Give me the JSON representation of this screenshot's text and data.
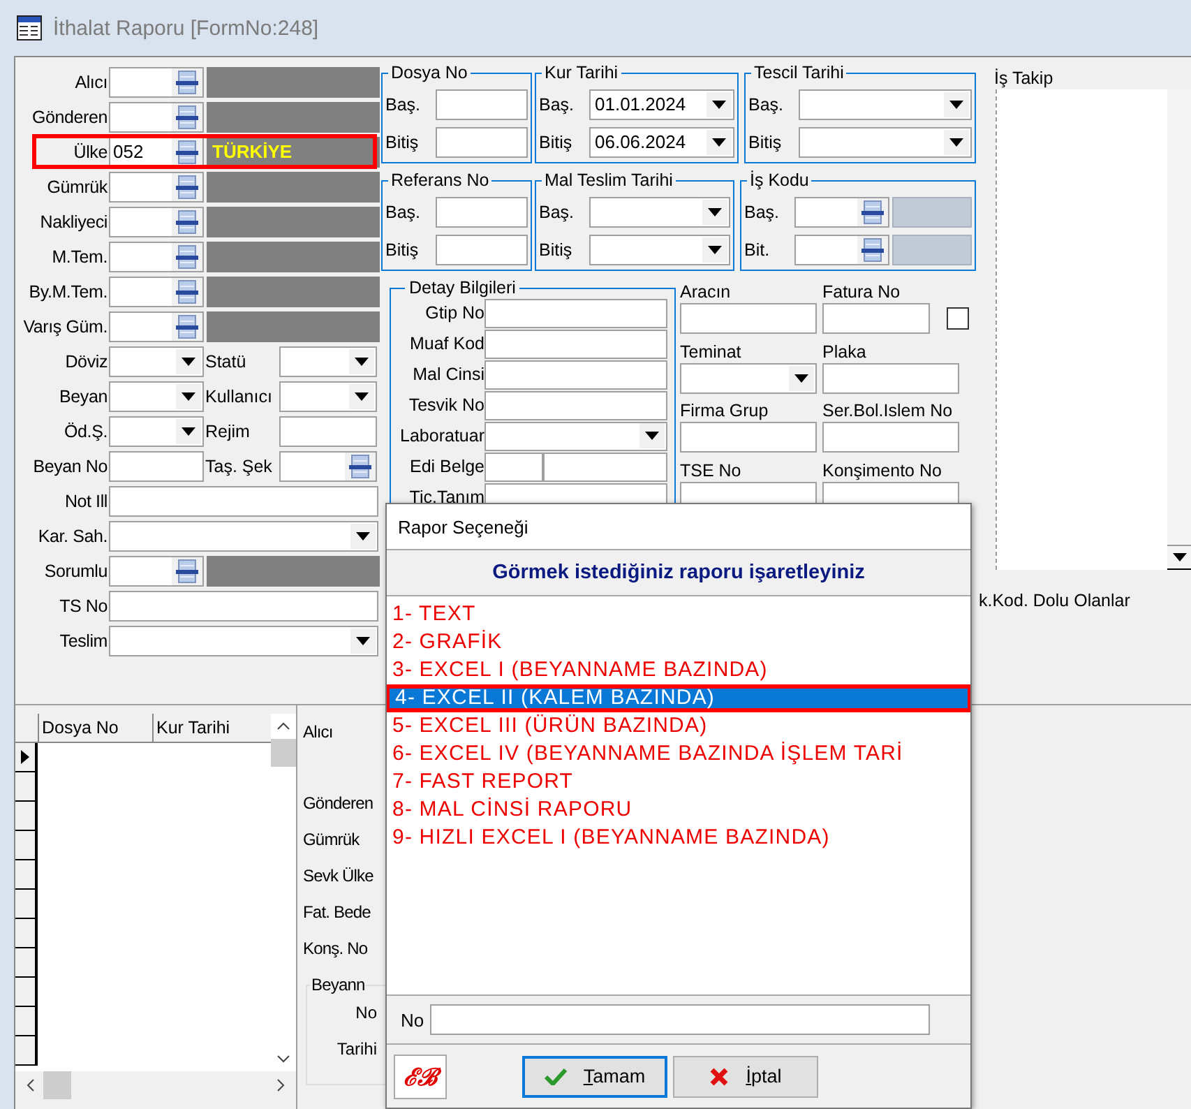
{
  "window": {
    "title": "İthalat Raporu [FormNo:248]"
  },
  "filters": [
    {
      "label": "Alıcı",
      "highlighted": false,
      "controls": [
        {
          "kind": "lookup"
        },
        {
          "kind": "name"
        }
      ]
    },
    {
      "label": "Gönderen",
      "highlighted": false,
      "controls": [
        {
          "kind": "lookup"
        },
        {
          "kind": "name"
        }
      ]
    },
    {
      "label": "Ülke",
      "highlighted": true,
      "controls": [
        {
          "kind": "lookup",
          "value": "052"
        },
        {
          "kind": "name",
          "value": "TÜRKİYE"
        }
      ]
    },
    {
      "label": "Gümrük",
      "highlighted": false,
      "controls": [
        {
          "kind": "lookup"
        },
        {
          "kind": "name"
        }
      ]
    },
    {
      "label": "Nakliyeci",
      "highlighted": false,
      "controls": [
        {
          "kind": "lookup"
        },
        {
          "kind": "name"
        }
      ]
    },
    {
      "label": "M.Tem.",
      "highlighted": false,
      "controls": [
        {
          "kind": "lookup"
        },
        {
          "kind": "name"
        }
      ]
    },
    {
      "label": "By.M.Tem.",
      "highlighted": false,
      "controls": [
        {
          "kind": "lookup"
        },
        {
          "kind": "name"
        }
      ]
    },
    {
      "label": "Varış Güm.",
      "highlighted": false,
      "controls": [
        {
          "kind": "lookup"
        },
        {
          "kind": "name"
        }
      ]
    },
    {
      "label": "Döviz",
      "highlighted": false,
      "controls": [
        {
          "kind": "combo"
        },
        {
          "kind": "label",
          "text": "Statü"
        },
        {
          "kind": "combo"
        }
      ]
    },
    {
      "label": "Beyan",
      "highlighted": false,
      "controls": [
        {
          "kind": "combo"
        },
        {
          "kind": "label",
          "text": "Kullanıcı"
        },
        {
          "kind": "combo"
        }
      ]
    },
    {
      "label": "Öd.Ş.",
      "highlighted": false,
      "controls": [
        {
          "kind": "combo"
        },
        {
          "kind": "label",
          "text": "Rejim"
        },
        {
          "kind": "text"
        }
      ]
    },
    {
      "label": "Beyan No",
      "highlighted": false,
      "controls": [
        {
          "kind": "text"
        },
        {
          "kind": "label",
          "text": "Taş. Şek"
        },
        {
          "kind": "lookup"
        }
      ]
    },
    {
      "label": "Not Ill",
      "highlighted": false,
      "controls": [
        {
          "kind": "text"
        }
      ]
    },
    {
      "label": "Kar. Sah.",
      "highlighted": false,
      "controls": [
        {
          "kind": "combo"
        }
      ]
    },
    {
      "label": "Sorumlu",
      "highlighted": false,
      "controls": [
        {
          "kind": "lookup"
        },
        {
          "kind": "name"
        }
      ]
    },
    {
      "label": "TS No",
      "highlighted": false,
      "controls": [
        {
          "kind": "text"
        }
      ]
    },
    {
      "label": "Teslim",
      "highlighted": false,
      "controls": [
        {
          "kind": "combo"
        }
      ]
    }
  ],
  "groups": [
    {
      "title": "Dosya No",
      "rows": [
        {
          "label": "Baş.",
          "kind": "text"
        },
        {
          "label": "Bitiş",
          "kind": "text"
        }
      ]
    },
    {
      "title": "Kur Tarihi",
      "rows": [
        {
          "label": "Baş.",
          "kind": "combo",
          "value": "01.01.2024"
        },
        {
          "label": "Bitiş",
          "kind": "combo",
          "value": "06.06.2024"
        }
      ]
    },
    {
      "title": "Tescil Tarihi",
      "rows": [
        {
          "label": "Baş.",
          "kind": "combo"
        },
        {
          "label": "Bitiş",
          "kind": "combo"
        }
      ]
    },
    {
      "title": "Referans No",
      "rows": [
        {
          "label": "Baş.",
          "kind": "text"
        },
        {
          "label": "Bitiş",
          "kind": "text"
        }
      ]
    },
    {
      "title": "Mal Teslim Tarihi",
      "rows": [
        {
          "label": "Baş.",
          "kind": "combo"
        },
        {
          "label": "Bitiş",
          "kind": "combo"
        }
      ]
    },
    {
      "title": "İş Kodu",
      "rows": [
        {
          "label": "Baş.",
          "kind": "lookup"
        },
        {
          "label": "Bit.",
          "kind": "lookup"
        }
      ]
    }
  ],
  "detail": {
    "title": "Detay Bilgileri",
    "rows": [
      {
        "label": "Gtip No",
        "kind": "text"
      },
      {
        "label": "Muaf Kod",
        "kind": "text"
      },
      {
        "label": "Mal Cinsi",
        "kind": "text"
      },
      {
        "label": "Tesvik No",
        "kind": "text"
      },
      {
        "label": "Laboratuar",
        "kind": "combo"
      },
      {
        "label": "Edi Belge",
        "kind": "split"
      },
      {
        "label": "Tic.Tanım",
        "kind": "text"
      }
    ]
  },
  "extra_fields": [
    {
      "label": "Aracın",
      "kind": "text"
    },
    {
      "label": "Fatura No",
      "kind": "text_check",
      "checked": false
    },
    {
      "label": "Teminat",
      "kind": "combo"
    },
    {
      "label": "Plaka",
      "kind": "text"
    },
    {
      "label": "Firma Grup",
      "kind": "text"
    },
    {
      "label": "Ser.Bol.Islem No",
      "kind": "text"
    },
    {
      "label": "TSE No",
      "kind": "text"
    },
    {
      "label": "Konşimento No",
      "kind": "text"
    }
  ],
  "is_takip": {
    "label": "İş Takip"
  },
  "side_note": "k.Kod. Dolu Olanlar",
  "grid": {
    "columns": [
      "Dosya No",
      "Kur Tarihi"
    ],
    "rows": [
      {
        "current": true
      },
      {
        "current": false
      },
      {
        "current": false
      },
      {
        "current": false
      },
      {
        "current": false
      },
      {
        "current": false
      },
      {
        "current": false
      },
      {
        "current": false
      },
      {
        "current": false
      },
      {
        "current": false
      },
      {
        "current": false
      }
    ]
  },
  "detail_panel": {
    "labels": [
      "Alıcı",
      "Gönderen",
      "Gümrük",
      "Sevk Ülke",
      "Fat. Bede",
      "Konş. No"
    ],
    "group": {
      "title": "Beyann",
      "labels": [
        "No",
        "Tarihi"
      ]
    }
  },
  "dialog": {
    "title": "Rapor Seçeneği",
    "heading": "Görmek istediğiniz raporu işaretleyiniz",
    "options": [
      {
        "label": "1- TEXT",
        "selected": false,
        "highlighted": false
      },
      {
        "label": "2- GRAFİK",
        "selected": false,
        "highlighted": false
      },
      {
        "label": "3- EXCEL I (BEYANNAME BAZINDA)",
        "selected": false,
        "highlighted": false
      },
      {
        "label": "4- EXCEL II (KALEM BAZINDA)",
        "selected": true,
        "highlighted": true
      },
      {
        "label": "5- EXCEL III (ÜRÜN BAZINDA)",
        "selected": false,
        "highlighted": false
      },
      {
        "label": "6- EXCEL IV (BEYANNAME BAZINDA İŞLEM TARİ",
        "selected": false,
        "highlighted": false
      },
      {
        "label": "7- FAST REPORT",
        "selected": false,
        "highlighted": false
      },
      {
        "label": "8- MAL CİNSİ RAPORU",
        "selected": false,
        "highlighted": false
      },
      {
        "label": "9- HIZLI EXCEL I (BEYANNAME BAZINDA)",
        "selected": false,
        "highlighted": false
      }
    ],
    "no_label": "No",
    "logo": "ℰℬ",
    "buttons": [
      {
        "label": "Tamam",
        "kind": "ok",
        "default": true
      },
      {
        "label": "İptal",
        "kind": "cancel",
        "default": false
      }
    ]
  }
}
